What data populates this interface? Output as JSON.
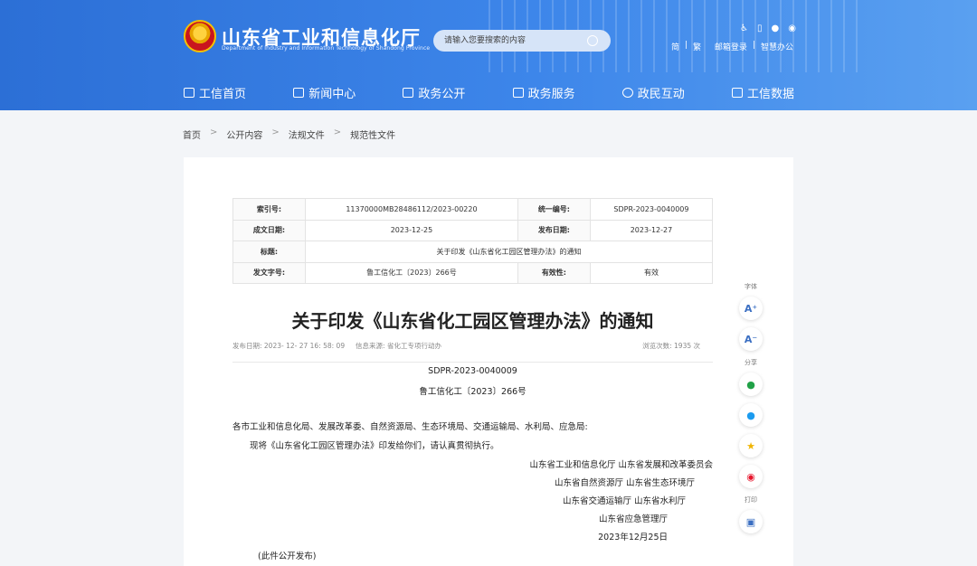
{
  "header": {
    "site_title": "山东省工业和信息化厅",
    "site_subtitle": "Department of Industry and Information Technology of Shandong Province",
    "search_placeholder": "请输入您要搜索的内容",
    "tools": [
      "简",
      "繁"
    ],
    "links": [
      "邮箱登录",
      "智慧办公"
    ]
  },
  "nav": [
    "工信首页",
    "新闻中心",
    "政务公开",
    "政务服务",
    "政民互动",
    "工信数据"
  ],
  "breadcrumb": [
    "首页",
    "公开内容",
    "法规文件",
    "规范性文件"
  ],
  "meta": {
    "index_label": "索引号:",
    "index_value": "11370000MB28486112/2023-00220",
    "uid_label": "统一编号:",
    "uid_value": "SDPR-2023-0040009",
    "date_label": "成文日期:",
    "date_value": "2023-12-25",
    "pub_label": "发布日期:",
    "pub_value": "2023-12-27",
    "title_label": "标题:",
    "title_value": "关于印发《山东省化工园区管理办法》的通知",
    "docno_label": "发文字号:",
    "docno_value": "鲁工信化工〔2023〕266号",
    "valid_label": "有效性:",
    "valid_value": "有效"
  },
  "article": {
    "title": "关于印发《山东省化工园区管理办法》的通知",
    "pub_info": "发布日期: 2023- 12- 27 16: 58: 09",
    "source": "信息来源: 省化工专项行动办",
    "views": "浏览次数:   1935   次",
    "code": "SDPR-2023-0040009",
    "docno": "鲁工信化工〔2023〕266号",
    "recipients": "各市工业和信息化局、发展改革委、自然资源局、生态环境局、交通运输局、水利局、应急局:",
    "body": "现将《山东省化工园区管理办法》印发给你们，请认真贯彻执行。",
    "signers": [
      "山东省工业和信息化厅 山东省发展和改革委员会",
      "山东省自然资源厅 山东省生态环境厅",
      "山东省交通运输厅 山东省水利厅",
      "山东省应急管理厅"
    ],
    "sign_date": "2023年12月25日",
    "note": "(此件公开发布)"
  },
  "side": {
    "font_label": "字体",
    "font_up": "A⁺",
    "font_down": "A⁻",
    "share_label": "分享",
    "print_label": "打印"
  }
}
